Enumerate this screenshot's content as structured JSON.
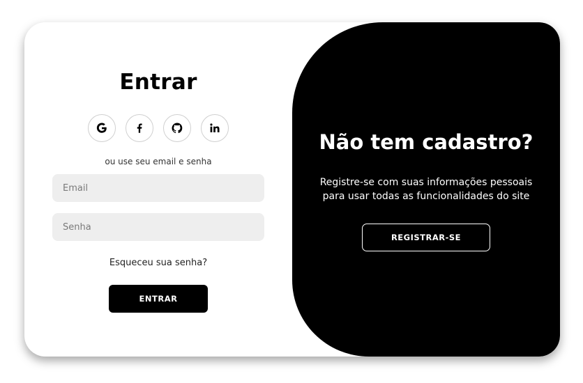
{
  "login": {
    "title": "Entrar",
    "socials": [
      {
        "name": "google",
        "icon": "google-icon"
      },
      {
        "name": "facebook",
        "icon": "facebook-icon"
      },
      {
        "name": "github",
        "icon": "github-icon"
      },
      {
        "name": "linkedin",
        "icon": "linkedin-icon"
      }
    ],
    "hint": "ou use seu email e senha",
    "email_placeholder": "Email",
    "password_placeholder": "Senha",
    "forgot_label": "Esqueceu sua senha?",
    "submit_label": "ENTRAR"
  },
  "register": {
    "title": "Não tem cadastro?",
    "text_line1": "Registre-se com suas informações pessoais",
    "text_line2": "para usar todas as funcionalidades do site",
    "button_label": "REGISTRAR-SE"
  },
  "colors": {
    "accent": "#000000",
    "field_bg": "#eeeeee",
    "background": "#ffffff"
  }
}
